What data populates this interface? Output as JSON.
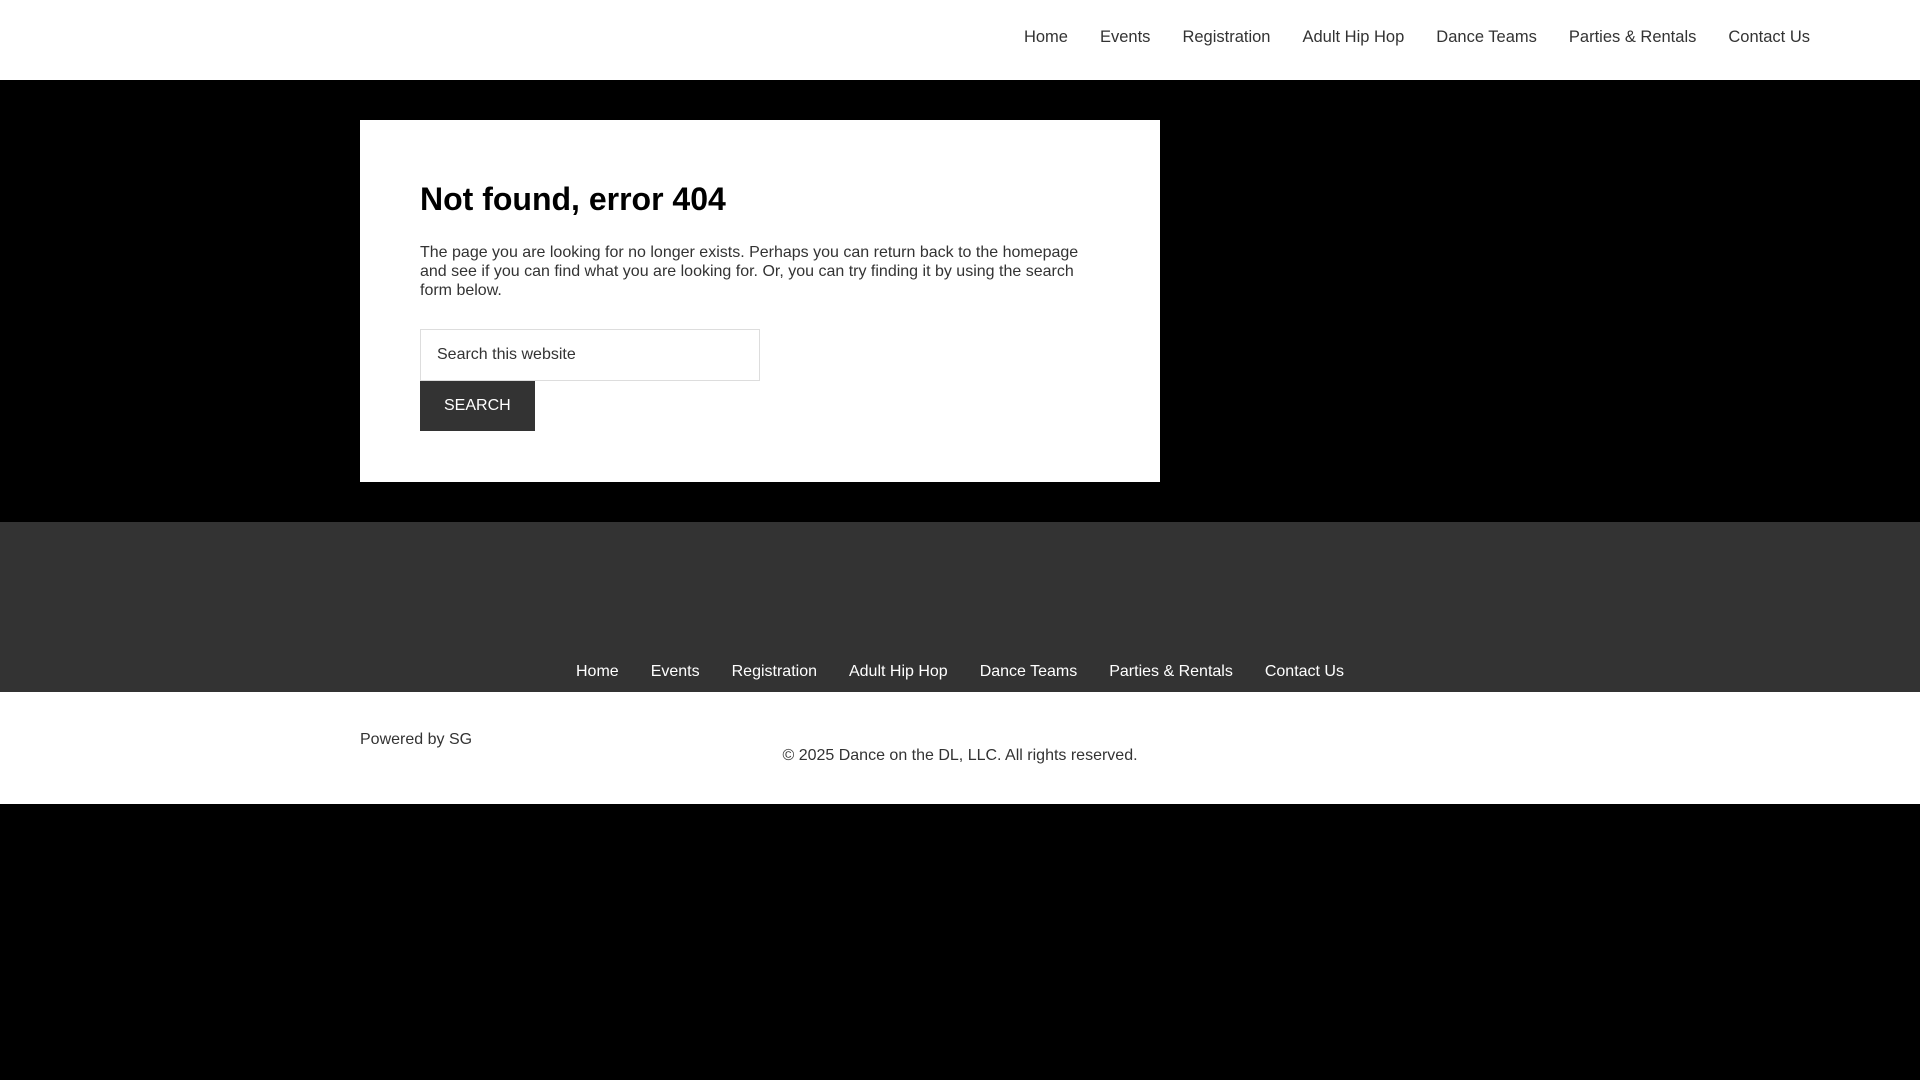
{
  "header": {
    "nav": [
      {
        "label": "Home"
      },
      {
        "label": "Events"
      },
      {
        "label": "Registration"
      },
      {
        "label": "Adult Hip Hop"
      },
      {
        "label": "Dance Teams"
      },
      {
        "label": "Parties & Rentals"
      },
      {
        "label": "Contact Us"
      }
    ]
  },
  "main": {
    "title": "Not found, error 404",
    "description": "The page you are looking for no longer exists. Perhaps you can return back to the homepage and see if you can find what you are looking for. Or, you can try finding it by using the search form below.",
    "search": {
      "placeholder": "Search this website",
      "button_label": "SEARCH"
    }
  },
  "footer_nav": [
    {
      "label": "Home"
    },
    {
      "label": "Events"
    },
    {
      "label": "Registration"
    },
    {
      "label": "Adult Hip Hop"
    },
    {
      "label": "Dance Teams"
    },
    {
      "label": "Parties & Rentals"
    },
    {
      "label": "Contact Us"
    }
  ],
  "footer": {
    "powered_by": "Powered by SG",
    "copyright": "© 2025 Dance on the DL, LLC. All rights reserved."
  },
  "colors": {
    "page_background": "#000000",
    "header_background": "#ffffff",
    "footer_band_background": "#333333",
    "button_background": "#333333",
    "text": "#333333"
  }
}
